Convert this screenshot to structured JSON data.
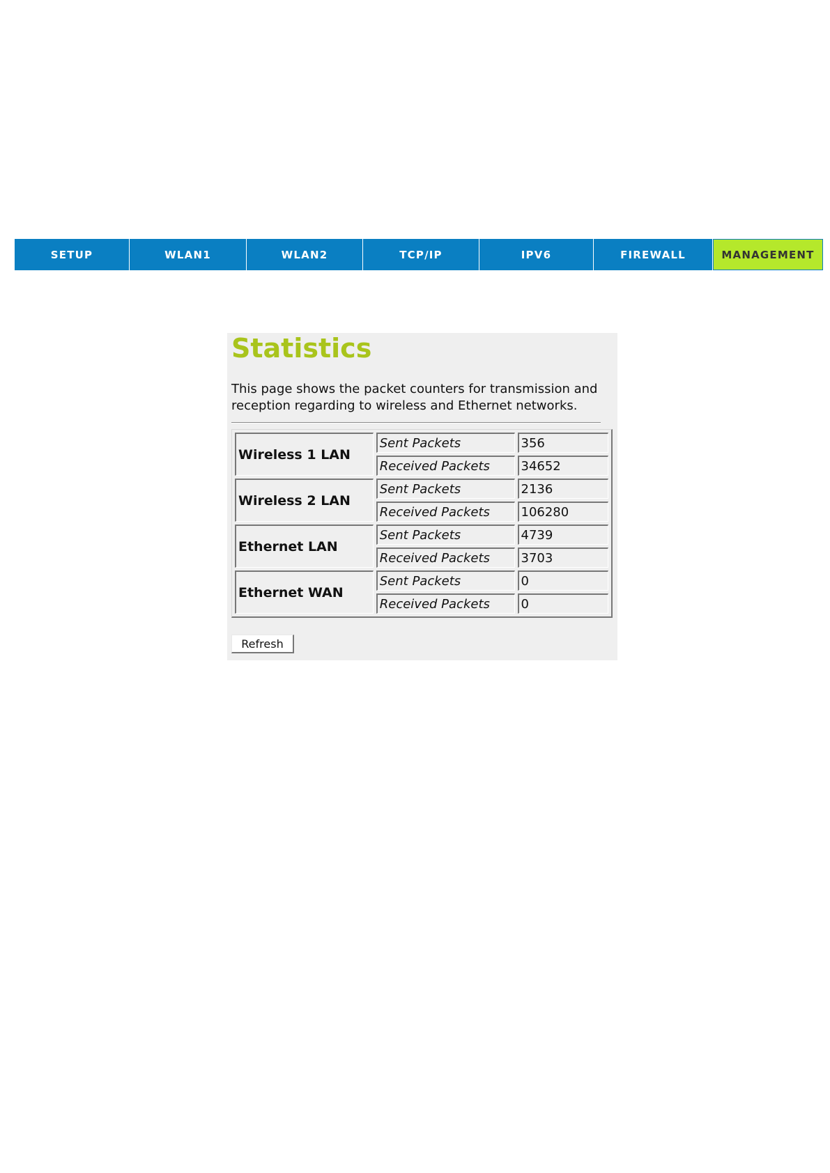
{
  "nav": {
    "tabs": [
      {
        "label": "SETUP",
        "active": false
      },
      {
        "label": "WLAN1",
        "active": false
      },
      {
        "label": "WLAN2",
        "active": false
      },
      {
        "label": "TCP/IP",
        "active": false
      },
      {
        "label": "IPV6",
        "active": false
      },
      {
        "label": "FIREWALL",
        "active": false
      },
      {
        "label": "MANAGEMENT",
        "active": true
      }
    ],
    "colors": {
      "tab_background": "#0a7fc2",
      "active_tab_background": "#b5e82b"
    }
  },
  "page": {
    "title": "Statistics",
    "description": "This page shows the packet counters for transmission and reception regarding to wireless and Ethernet networks.",
    "title_color": "#a9c41c"
  },
  "stats": {
    "interfaces": [
      {
        "name": "Wireless 1 LAN",
        "rows": [
          {
            "metric": "Sent Packets",
            "value": "356"
          },
          {
            "metric": "Received Packets",
            "value": "34652"
          }
        ]
      },
      {
        "name": "Wireless 2 LAN",
        "rows": [
          {
            "metric": "Sent Packets",
            "value": "2136"
          },
          {
            "metric": "Received Packets",
            "value": "106280"
          }
        ]
      },
      {
        "name": "Ethernet LAN",
        "rows": [
          {
            "metric": "Sent Packets",
            "value": "4739"
          },
          {
            "metric": "Received Packets",
            "value": "3703"
          }
        ]
      },
      {
        "name": "Ethernet WAN",
        "rows": [
          {
            "metric": "Sent Packets",
            "value": "0"
          },
          {
            "metric": "Received Packets",
            "value": "0"
          }
        ]
      }
    ]
  },
  "actions": {
    "refresh_label": "Refresh"
  }
}
